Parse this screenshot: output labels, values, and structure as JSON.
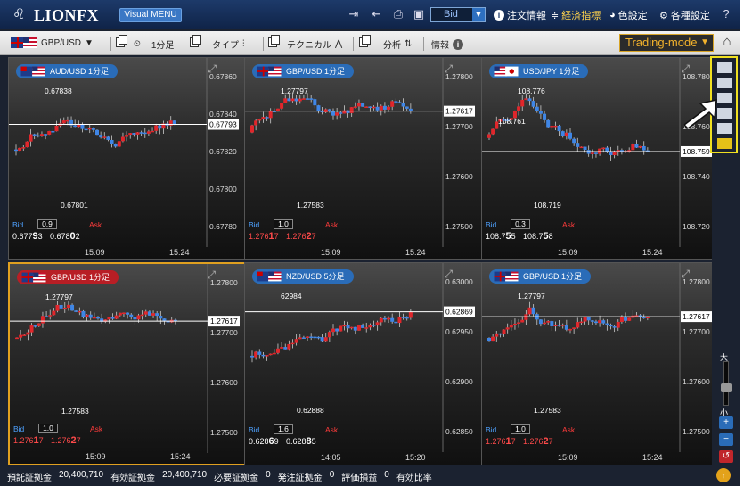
{
  "app": {
    "logo_text": "LIONFX",
    "visual_menu": "Visual MENU",
    "bid_select": "Bid",
    "links": {
      "orders": "注文情報",
      "econ": "経済指標",
      "color": "色設定",
      "settings": "各種設定"
    }
  },
  "subbar": {
    "pair": "GBP/USD",
    "timeframe": "1分足",
    "type": "タイプ",
    "technical": "テクニカル",
    "analysis": "分析",
    "info": "情報",
    "trading_mode": "Trading-mode"
  },
  "panels": [
    {
      "tag": "AUD/USD 1分足",
      "flags": [
        "au",
        "us"
      ],
      "y_ticks": [
        "0.67860",
        "0.67840",
        "0.67820",
        "0.67800",
        "0.67780"
      ],
      "current": "0.67793",
      "high_label": "0.67838",
      "low_label": "0.67801",
      "bid_label": "Bid",
      "ask_label": "Ask",
      "spread": "0.9",
      "bid_main": "0.677",
      "bid_big": "9",
      "bid_small": "3",
      "ask_main": "0.678",
      "ask_big": "0",
      "ask_small": "2",
      "times": [
        "15:09",
        "15:24"
      ]
    },
    {
      "tag": "GBP/USD 1分足",
      "flags": [
        "uk",
        "us"
      ],
      "y_ticks": [
        "1.27800",
        "1.27700",
        "1.27600",
        "1.27500"
      ],
      "current": "1.27617",
      "high_label": "1.27797",
      "low_label": "1.27583",
      "bid_label": "Bid",
      "ask_label": "Ask",
      "spread": "1.0",
      "bid_main": "1.276",
      "bid_big": "1",
      "bid_small": "7",
      "ask_main": "1.276",
      "ask_big": "2",
      "ask_small": "7",
      "times": [
        "15:09",
        "15:24"
      ]
    },
    {
      "tag": "USD/JPY 1分足",
      "flags": [
        "us",
        "jp"
      ],
      "y_ticks": [
        "108.780",
        "108.760",
        "108.740",
        "108.720"
      ],
      "current": "108.759",
      "high_label": "108.776",
      "mid_label": "108.761",
      "low_label": "108.719",
      "bid_label": "Bid",
      "ask_label": "Ask",
      "spread": "0.3",
      "bid_main": "108.7",
      "bid_big": "5",
      "bid_small": "5",
      "ask_main": "108.7",
      "ask_big": "5",
      "ask_small": "8",
      "times": [
        "15:09",
        "15:24"
      ]
    },
    {
      "tag": "GBP/USD 1分足",
      "flags": [
        "uk",
        "us"
      ],
      "y_ticks": [
        "1.27800",
        "1.27700",
        "1.27600",
        "1.27500"
      ],
      "current": "1.27617",
      "high_label": "1.27797",
      "low_label": "1.27583",
      "bid_label": "Bid",
      "ask_label": "Ask",
      "spread": "1.0",
      "bid_main": "1.276",
      "bid_big": "1",
      "bid_small": "7",
      "ask_main": "1.276",
      "ask_big": "2",
      "ask_small": "7",
      "times": [
        "15:09",
        "15:24"
      ]
    },
    {
      "tag": "NZD/USD 5分足",
      "flags": [
        "nz",
        "us"
      ],
      "y_ticks": [
        "0.63000",
        "0.62950",
        "0.62900",
        "0.62850"
      ],
      "current": "0.62869",
      "high_label": "62984",
      "low_label": "0.62888",
      "bid_label": "Bid",
      "ask_label": "Ask",
      "spread": "1.6",
      "bid_main": "0.628",
      "bid_big": "6",
      "bid_small": "9",
      "ask_main": "0.628",
      "ask_big": "8",
      "ask_small": "5",
      "times": [
        "14:05",
        "15:20"
      ]
    },
    {
      "tag": "GBP/USD 1分足",
      "flags": [
        "uk",
        "us"
      ],
      "y_ticks": [
        "1.27800",
        "1.27700",
        "1.27600",
        "1.27500"
      ],
      "current": "1.27617",
      "high_label": "1.27797",
      "low_label": "1.27583",
      "bid_label": "Bid",
      "ask_label": "Ask",
      "spread": "1.0",
      "bid_main": "1.276",
      "bid_big": "1",
      "bid_small": "7",
      "ask_main": "1.276",
      "ask_big": "2",
      "ask_small": "7",
      "times": [
        "15:09",
        "15:24"
      ]
    }
  ],
  "side": {
    "zoom_large": "大",
    "zoom_small": "小"
  },
  "footer": {
    "items": [
      "預託証拠金",
      "20,400,710",
      "有効証拠金",
      "20,400,710",
      "必要証拠金",
      "0",
      "発注証拠金",
      "0",
      "評価損益",
      "0",
      "有効比率"
    ]
  }
}
